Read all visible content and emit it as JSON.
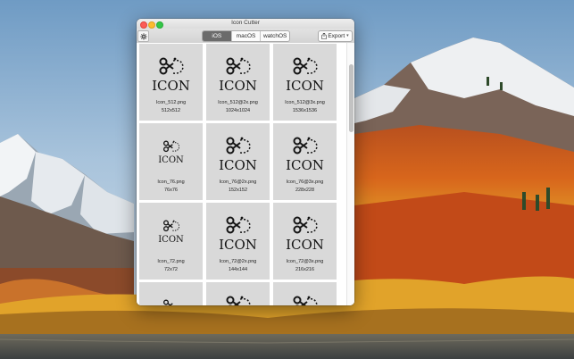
{
  "window": {
    "title": "Icon Cutter",
    "tabs": [
      {
        "label": "iOS",
        "active": true
      },
      {
        "label": "macOS",
        "active": false
      },
      {
        "label": "watchOS",
        "active": false
      }
    ],
    "export_label": "Export",
    "settings_icon": "gear-icon",
    "export_icon": "share-icon"
  },
  "icons": [
    {
      "word": "ICON",
      "file": "Icon_512.png",
      "size": "512x512"
    },
    {
      "word": "ICON",
      "file": "Icon_512@2x.png",
      "size": "1024x1024"
    },
    {
      "word": "ICON",
      "file": "Icon_512@3x.png",
      "size": "1536x1536"
    },
    {
      "word": "ICON",
      "file": "Icon_76.png",
      "size": "76x76"
    },
    {
      "word": "ICON",
      "file": "Icon_76@2x.png",
      "size": "152x152"
    },
    {
      "word": "ICON",
      "file": "Icon_76@3x.png",
      "size": "228x228"
    },
    {
      "word": "ICON",
      "file": "Icon_72.png",
      "size": "72x72"
    },
    {
      "word": "ICON",
      "file": "Icon_72@2x.png",
      "size": "144x144"
    },
    {
      "word": "ICON",
      "file": "Icon_72@3x.png",
      "size": "216x216"
    }
  ],
  "colors": {
    "active_tab": "#6b6b6b",
    "tile": "#d9d9d9"
  }
}
